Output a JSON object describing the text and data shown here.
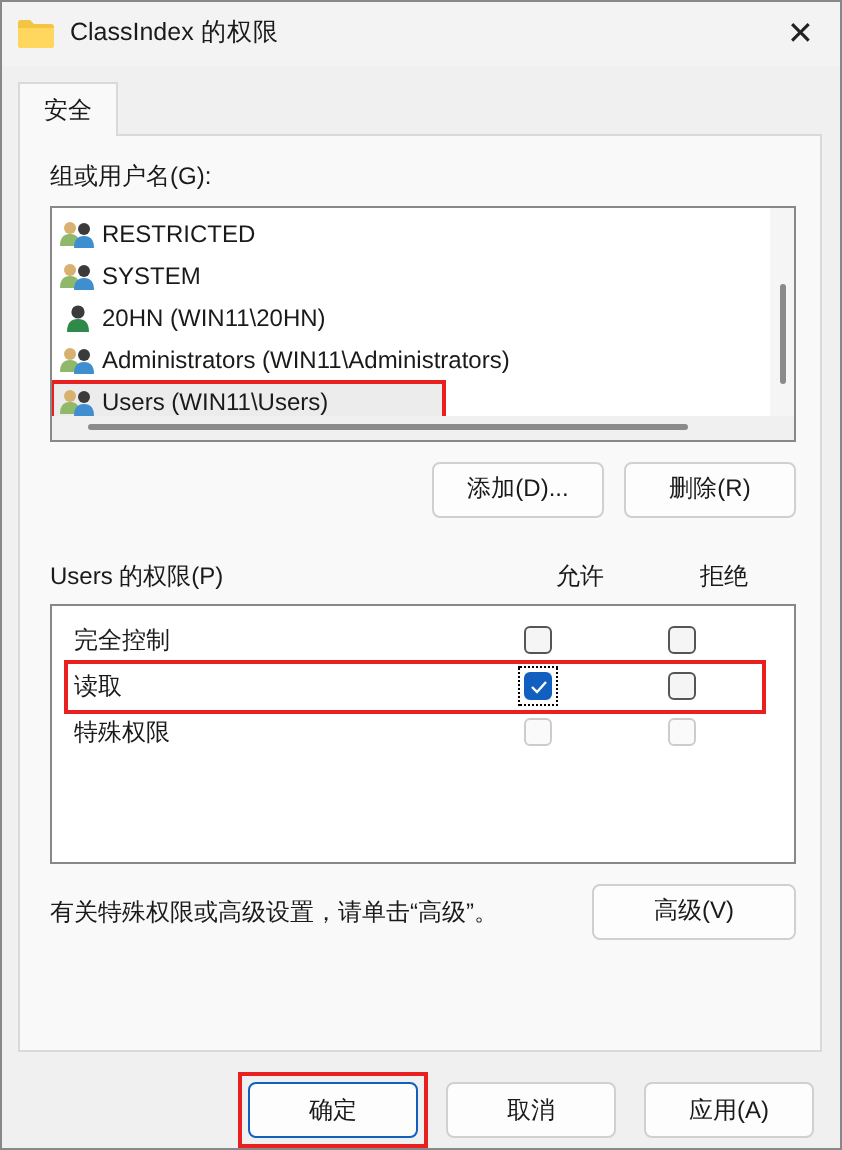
{
  "window": {
    "title": "ClassIndex 的权限",
    "close": "✕"
  },
  "tabs": [
    {
      "label": "安全",
      "selected": true
    }
  ],
  "users": {
    "label": "组或用户名(G):",
    "items": [
      {
        "name": "RESTRICTED",
        "kind": "group",
        "selected": false,
        "highlighted": false
      },
      {
        "name": "SYSTEM",
        "kind": "group",
        "selected": false,
        "highlighted": false
      },
      {
        "name": "20HN (WIN11\\20HN)",
        "kind": "user",
        "selected": false,
        "highlighted": false
      },
      {
        "name": "Administrators (WIN11\\Administrators)",
        "kind": "group",
        "selected": false,
        "highlighted": false
      },
      {
        "name": "Users (WIN11\\Users)",
        "kind": "group",
        "selected": true,
        "highlighted": true
      }
    ],
    "buttons": [
      "添加(D)...",
      "删除(R)"
    ]
  },
  "permissions": {
    "label": "Users 的权限(P)",
    "allow_heading": "允许",
    "deny_heading": "拒绝",
    "rows": [
      {
        "name": "完全控制",
        "highlighted": false,
        "allow": {
          "checked": false,
          "disabled": false,
          "focused": false
        },
        "deny": {
          "checked": false,
          "disabled": false,
          "focused": false
        }
      },
      {
        "name": "读取",
        "highlighted": true,
        "allow": {
          "checked": true,
          "disabled": false,
          "focused": true
        },
        "deny": {
          "checked": false,
          "disabled": false,
          "focused": false
        }
      },
      {
        "name": "特殊权限",
        "highlighted": false,
        "allow": {
          "checked": false,
          "disabled": true,
          "focused": false
        },
        "deny": {
          "checked": false,
          "disabled": true,
          "focused": false
        }
      }
    ]
  },
  "advanced": {
    "text": "有关特殊权限或高级设置，请单击“高级”。",
    "button": "高级(V)"
  },
  "footer": [
    {
      "label": "确定",
      "default": true,
      "highlighted": true
    },
    {
      "label": "取消",
      "default": false,
      "highlighted": false
    },
    {
      "label": "应用(A)",
      "default": false,
      "highlighted": false
    }
  ]
}
